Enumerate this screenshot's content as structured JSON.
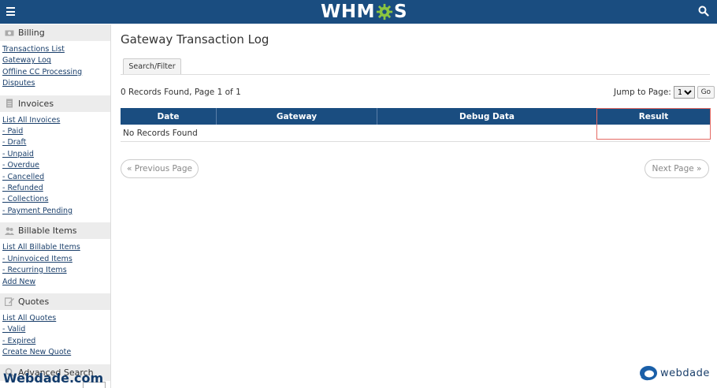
{
  "header": {
    "brand_left": "WHM",
    "brand_right": "S"
  },
  "sidebar": {
    "groups": [
      {
        "title": "Billing",
        "links": [
          "Transactions List",
          "Gateway Log",
          "Offline CC Processing",
          "Disputes"
        ]
      },
      {
        "title": "Invoices",
        "links": [
          "List All Invoices",
          "- Paid",
          "- Draft",
          "- Unpaid",
          "- Overdue",
          "- Cancelled",
          "- Refunded",
          "- Collections",
          "- Payment Pending"
        ]
      },
      {
        "title": "Billable Items",
        "links": [
          "List All Billable Items",
          "- Uninvoiced Items",
          "- Recurring Items",
          "Add New"
        ]
      },
      {
        "title": "Quotes",
        "links": [
          "List All Quotes",
          "- Valid",
          "- Expired",
          "Create New Quote"
        ]
      },
      {
        "title": "Advanced Search",
        "links": []
      }
    ]
  },
  "main": {
    "title": "Gateway Transaction Log",
    "tab_label": "Search/Filter",
    "records_text": "0 Records Found, Page 1 of 1",
    "jump_label": "Jump to Page:",
    "jump_value": "1",
    "go_label": "Go",
    "columns": [
      "Date",
      "Gateway",
      "Debug Data",
      "Result"
    ],
    "empty_text": "No Records Found",
    "prev_label": "« Previous Page",
    "next_label": "Next Page »"
  },
  "watermark": {
    "left": "Webdade.com",
    "right": "webdade"
  },
  "colors": {
    "header_bg": "#1a4d80",
    "highlight": "#e46a64",
    "link": "#1a3f6b"
  }
}
